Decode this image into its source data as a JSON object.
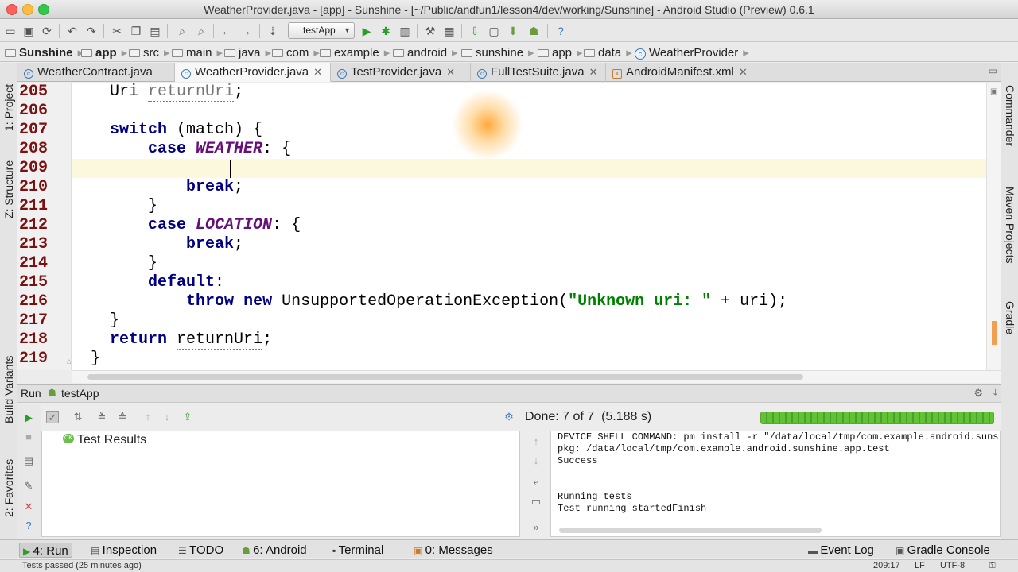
{
  "window": {
    "title": "WeatherProvider.java - [app] - Sunshine - [~/Public/andfun1/lesson4/dev/working/Sunshine] - Android Studio (Preview) 0.6.1"
  },
  "toolbar": {
    "run_config": "testApp"
  },
  "breadcrumbs": [
    "Sunshine",
    "app",
    "src",
    "main",
    "java",
    "com",
    "example",
    "android",
    "sunshine",
    "app",
    "data",
    "WeatherProvider"
  ],
  "tabs": [
    {
      "label": "WeatherContract.java",
      "active": false
    },
    {
      "label": "WeatherProvider.java",
      "active": true
    },
    {
      "label": "TestProvider.java",
      "active": false
    },
    {
      "label": "FullTestSuite.java",
      "active": false
    },
    {
      "label": "AndroidManifest.xml",
      "active": false
    }
  ],
  "left_tools": {
    "project": "1: Project",
    "structure": "Z: Structure",
    "build_variants": "Build Variants",
    "favorites": "2: Favorites"
  },
  "right_tools": {
    "commander": "Commander",
    "maven": "Maven Projects",
    "gradle": "Gradle"
  },
  "editor": {
    "line_numbers": [
      "205",
      "206",
      "207",
      "208",
      "209",
      "210",
      "211",
      "212",
      "213",
      "214",
      "215",
      "216",
      "217",
      "218",
      "219"
    ],
    "code": {
      "l205_type": "Uri",
      "l205_var": "returnUri",
      "l205_end": ";",
      "l207_kw": "switch",
      "l207_rest": " (match) {",
      "l208_kw": "case",
      "l208_const": "WEATHER",
      "l208_rest": ": {",
      "l210_kw": "break",
      "l210_rest": ";",
      "l211": "}",
      "l212_kw": "case",
      "l212_const": "LOCATION",
      "l212_rest": ": {",
      "l213_kw": "break",
      "l213_rest": ";",
      "l214": "}",
      "l215_kw": "default",
      "l215_rest": ":",
      "l216_kw1": "throw",
      "l216_kw2": "new",
      "l216_mid": " UnsupportedOperationException(",
      "l216_str": "\"Unknown uri: \"",
      "l216_end": " + uri);",
      "l217": "}",
      "l218_kw": "return",
      "l218_var": "returnUri",
      "l218_end": ";",
      "l219": "}"
    }
  },
  "run_panel": {
    "label": "Run",
    "config": "testApp",
    "status": "Done: 7 of 7  (5.188 s)",
    "progress": 1.0,
    "tree_root": "Test Results",
    "console_lines": [
      "DEVICE SHELL COMMAND: pm install -r \"/data/local/tmp/com.example.android.suns",
      "pkg: /data/local/tmp/com.example.android.sunshine.app.test",
      "Success",
      "",
      "",
      "Running tests",
      "Test running startedFinish"
    ]
  },
  "bottom_tabs": {
    "run": "4: Run",
    "inspection": "Inspection",
    "todo": "TODO",
    "android": "6: Android",
    "terminal": "Terminal",
    "messages": "0: Messages",
    "event_log": "Event Log",
    "gradle_console": "Gradle Console"
  },
  "status": {
    "message": "Tests passed (25 minutes ago)",
    "position": "209:17",
    "line_sep": "LF",
    "encoding": "UTF-8"
  },
  "colors": {
    "keyword": "#000080",
    "constant": "#660e7a",
    "string": "#008000",
    "line_number": "#7a1010",
    "progress": "#4aa02a"
  }
}
